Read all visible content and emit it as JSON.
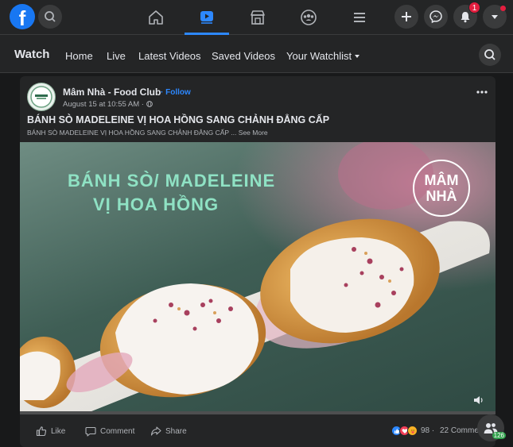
{
  "topnav": {
    "logo": "f",
    "notifications_badge": "1"
  },
  "watch": {
    "title": "Watch",
    "links": [
      "Home",
      "Live",
      "Latest Videos",
      "Saved Videos",
      "Your Watchlist"
    ]
  },
  "post": {
    "page_name": "Mâm Nhà - Food Club",
    "follow": "Follow",
    "time": "August 15 at 10:55 AM",
    "title": "BÁNH SÒ MADELEINE VỊ HOA HỒNG SANG CHẢNH ĐẲNG CẤP",
    "description": "BÁNH SÒ MADELEINE VỊ HOA HỒNG SANG CHẢNH ĐẲNG CẤP ...",
    "see_more": "See More",
    "video": {
      "title_line1": "BÁNH SÒ/ MADELEINE",
      "title_line2": "VỊ HOA HỒNG",
      "logo_line1": "MÂM",
      "logo_line2": "NHÀ"
    },
    "actions": {
      "like": "Like",
      "comment": "Comment",
      "share": "Share"
    },
    "reaction_count": "98",
    "comment_count": "22 Comme",
    "colors": {
      "like": "#2d88ff",
      "love": "#f33e58",
      "care": "#f7b125"
    }
  },
  "chat": {
    "count": "126"
  }
}
